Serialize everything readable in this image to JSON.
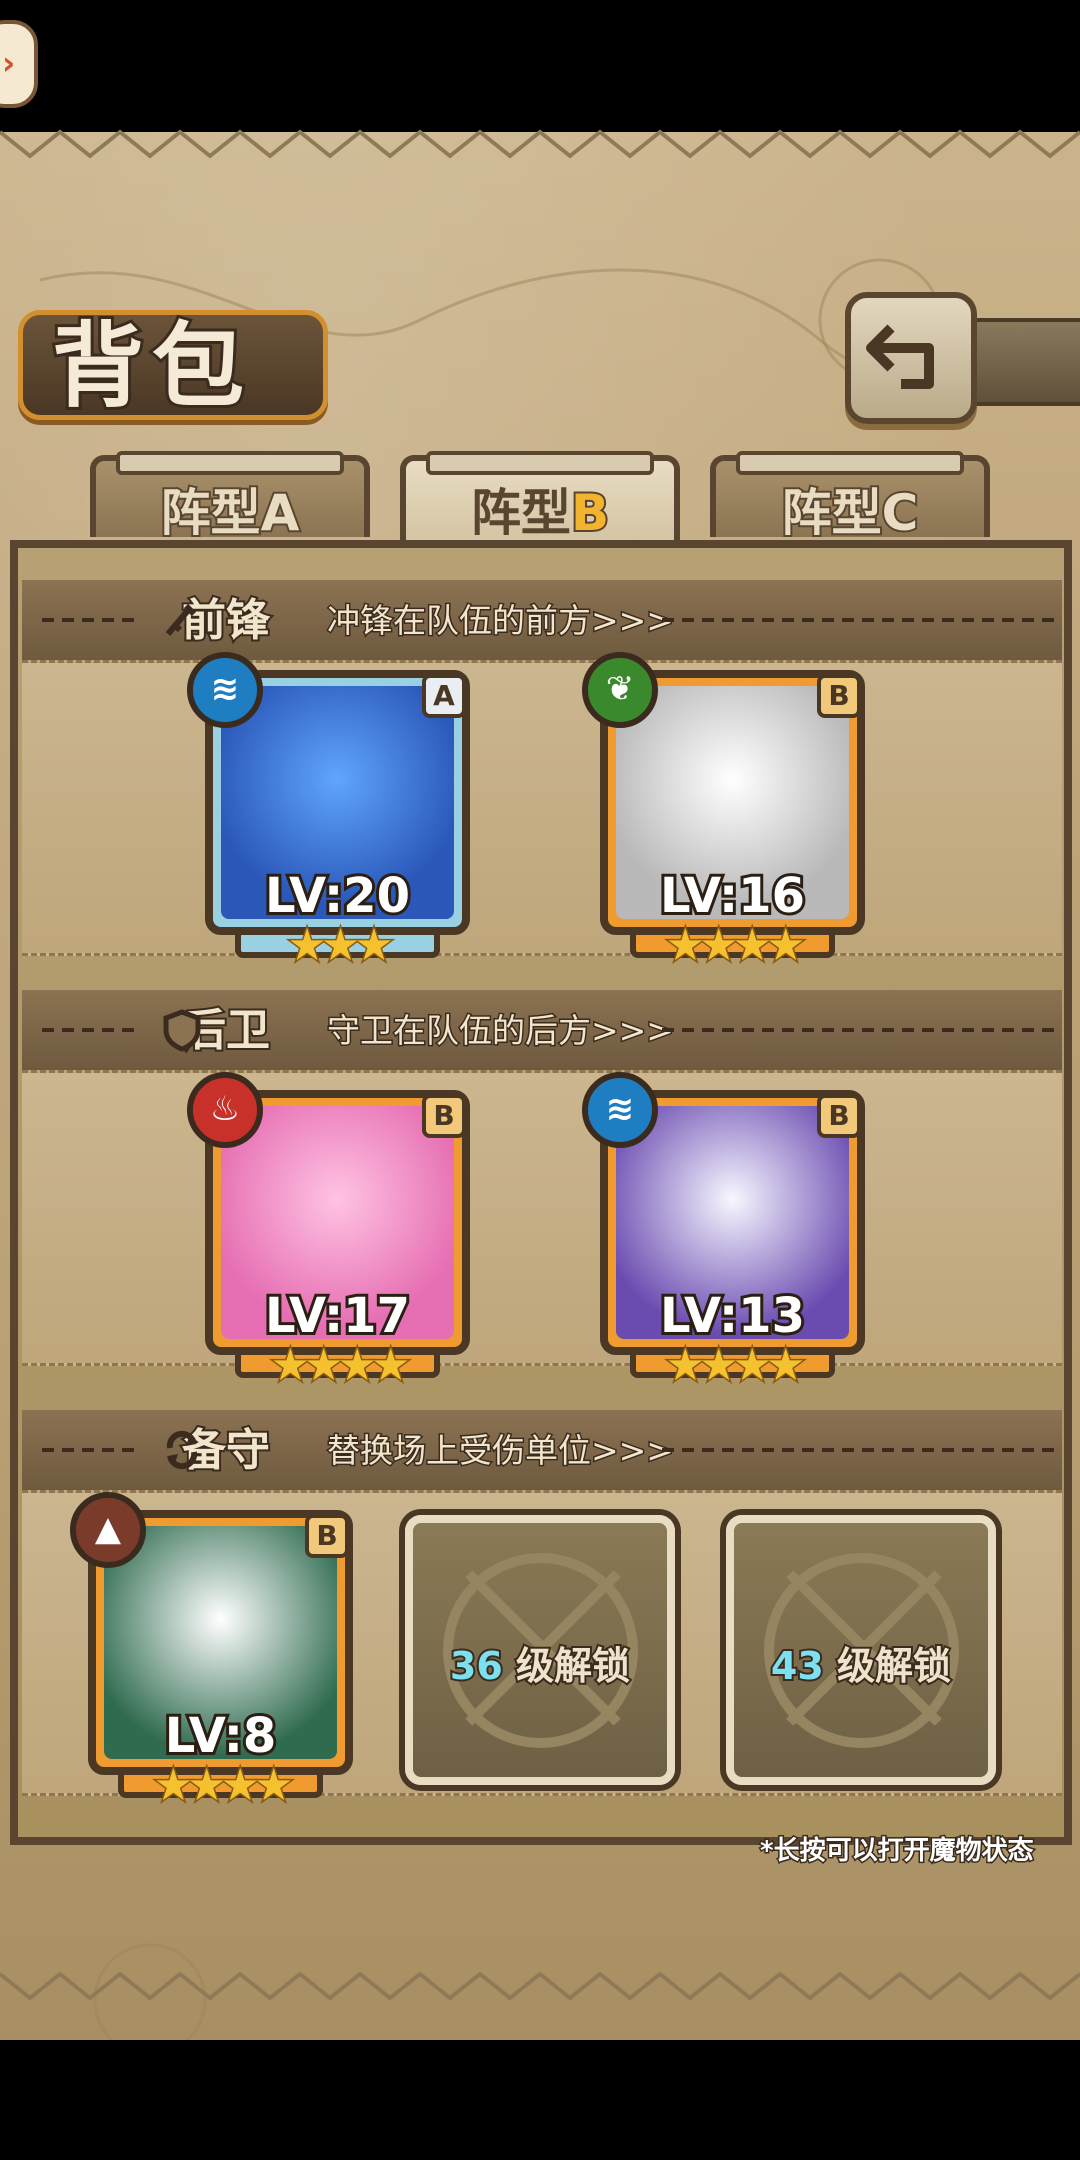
{
  "header": {
    "title": "背包"
  },
  "tabs": [
    {
      "label": "阵型",
      "tag": "A",
      "active": false
    },
    {
      "label": "阵型",
      "tag": "B",
      "active": true
    },
    {
      "label": "阵型",
      "tag": "C",
      "active": false
    }
  ],
  "sections": {
    "front": {
      "title": "前锋",
      "desc": "冲锋在队伍的前方>>>"
    },
    "back": {
      "title": "后卫",
      "desc": "守卫在队伍的后方>>>"
    },
    "reserve": {
      "title": "备守",
      "desc": "替换场上受伤单位>>>"
    }
  },
  "units": {
    "front_1": {
      "level": "LV:20",
      "rank": "A",
      "element": "water",
      "stars": "★★★"
    },
    "front_2": {
      "level": "LV:16",
      "rank": "B",
      "element": "leaf",
      "stars": "★★★★"
    },
    "back_1": {
      "level": "LV:17",
      "rank": "B",
      "element": "fire",
      "stars": "★★★★"
    },
    "back_2": {
      "level": "LV:13",
      "rank": "B",
      "element": "water",
      "stars": "★★★★"
    },
    "reserve_1": {
      "level": "LV:8",
      "rank": "B",
      "element": "earth",
      "stars": "★★★★"
    }
  },
  "locked_slots": [
    {
      "level": "36",
      "text": "级解锁"
    },
    {
      "level": "43",
      "text": "级解锁"
    }
  ],
  "hint": "*长按可以打开魔物状态",
  "colors": {
    "frame_orange": "#ef9b2f",
    "frame_blue": "#9ad1e2",
    "panel_border": "#5a4630",
    "unlock_level": "#7be0f0"
  }
}
